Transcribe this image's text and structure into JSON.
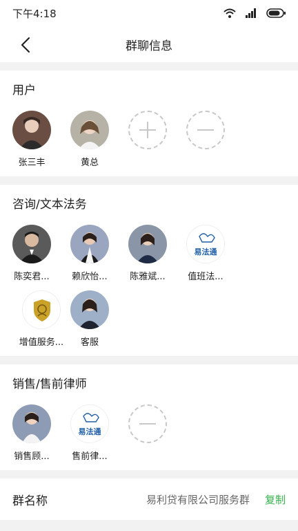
{
  "status": {
    "time": "下午4:18"
  },
  "nav": {
    "title": "群聊信息"
  },
  "users": {
    "title": "用户",
    "members": [
      "张三丰",
      "黄总"
    ]
  },
  "consult": {
    "title": "咨询/文本法务",
    "members": [
      "陈奕君...",
      "赖欣怡...",
      "陈雅斌...",
      "值班法...",
      "增值服务...",
      "客服"
    ],
    "logo_text": "易法通"
  },
  "sales": {
    "title": "销售/售前律师",
    "members": [
      "销售顾...",
      "售前律..."
    ],
    "logo_text": "易法通"
  },
  "group_name": {
    "label": "群名称",
    "value": "易利贷有限公司服务群",
    "action": "复制"
  },
  "colors": {
    "accent": "#33b14a",
    "logo_blue": "#1f5fa8",
    "badge_gold": "#c9a227"
  }
}
